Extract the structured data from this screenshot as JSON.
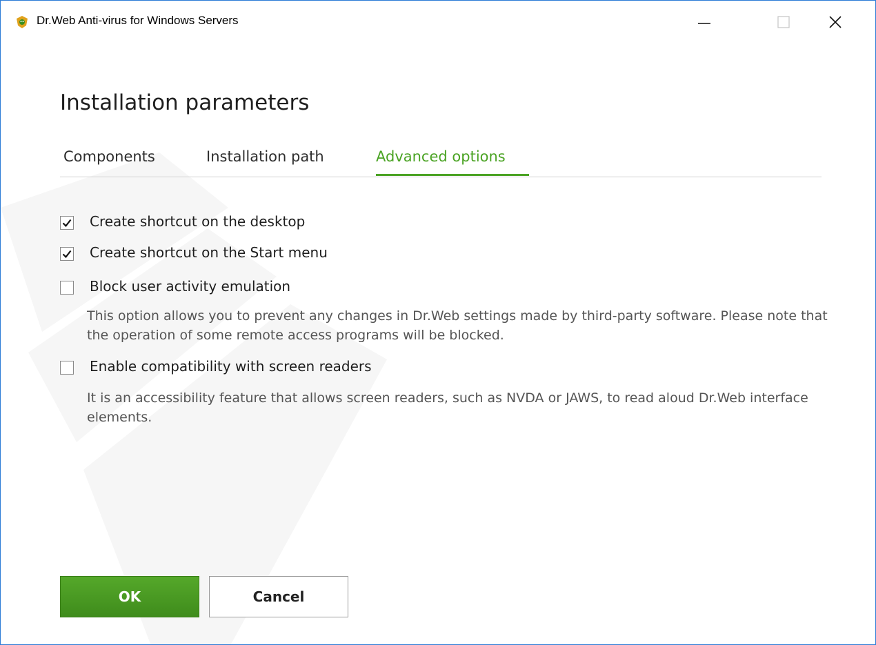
{
  "window": {
    "title": "Dr.Web Anti-virus for Windows Servers",
    "icons": {
      "app": "drweb-spider-icon",
      "minimize": "minimize-icon",
      "maximize": "maximize-icon",
      "close": "close-icon"
    }
  },
  "page": {
    "heading": "Installation parameters"
  },
  "tabs": [
    {
      "label": "Components",
      "active": false
    },
    {
      "label": "Installation path",
      "active": false
    },
    {
      "label": "Advanced options",
      "active": true
    }
  ],
  "options": [
    {
      "label": "Create shortcut on the desktop",
      "checked": true
    },
    {
      "label": "Create shortcut on the Start menu",
      "checked": true
    },
    {
      "label": "Block user activity emulation",
      "checked": false,
      "description": "This option allows you to prevent any changes in Dr.Web settings made by third-party software. Please note that the operation of some remote access programs will be blocked."
    },
    {
      "label": "Enable compatibility with screen readers",
      "checked": false,
      "description": "It is an accessibility feature that allows screen readers, such as NVDA or JAWS, to read aloud Dr.Web interface elements."
    }
  ],
  "buttons": {
    "ok": "OK",
    "cancel": "Cancel"
  },
  "colors": {
    "accent": "#4aa323",
    "window_border": "#2b7bd6",
    "ok_button": "#4b9b22"
  }
}
